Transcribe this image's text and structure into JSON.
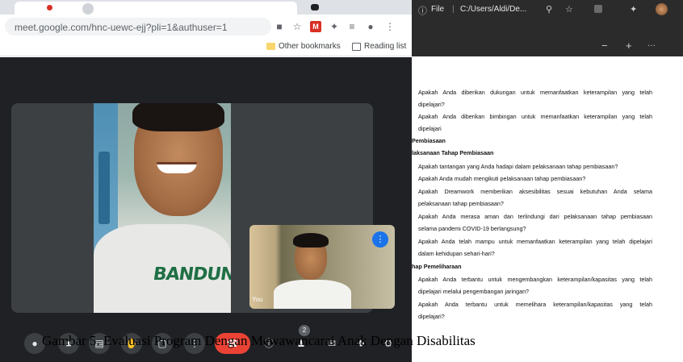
{
  "browser": {
    "url": "meet.google.com/hnc-uewc-ejj?pli=1&authuser=1",
    "bookmarks": [
      "Other bookmarks",
      "Reading list"
    ]
  },
  "meet": {
    "self_label": "You",
    "shirt_print": "BANDUN",
    "participant_badge": "2"
  },
  "edge": {
    "file_label": "File",
    "path": "C:/Users/Aldi/De...",
    "toolbar_glyphs": [
      "−",
      "+",
      "···"
    ]
  },
  "pdf": {
    "lines": [
      {
        "text": "Apakah Anda diberikan dukungan untuk memanfaatkan keterampilan yang telah",
        "style": "j"
      },
      {
        "text": "dipelajari?",
        "style": ""
      },
      {
        "text": "Apakah Anda diberikan bimbingan untuk memanfaatkan keterampilan yang telah",
        "style": "j"
      },
      {
        "text": "dipelajari",
        "style": ""
      },
      {
        "text": "Pembiasaan",
        "style": "b"
      },
      {
        "text": "laksanaan Tahap Pembiasaan",
        "style": "b"
      },
      {
        "text": "Apakah tantangan yang Anda hadapi dalam pelaksanaan tahap pembiasaan?",
        "style": ""
      },
      {
        "text": "Apakah Anda mudah mengikuti pelaksanaan tahap pembiasaan?",
        "style": ""
      },
      {
        "text": "Apakah Dreamwork memberikan aksesibilitas sesuai kebutuhan Anda selama",
        "style": "j"
      },
      {
        "text": "pelaksanaan tahap pembiasaan?",
        "style": ""
      },
      {
        "text": "Apakah Anda merasa aman dan terlindungi dari pelaksanaan tahap pembiasaan",
        "style": "j"
      },
      {
        "text": "selama pandemi COVID-19 berlangsung?",
        "style": ""
      },
      {
        "text": "Apakah Anda telah mampu untuk memanfaatkan keterampilan yang telah dipelajari",
        "style": "j"
      },
      {
        "text": "dalam kehidupan sehari-hari?",
        "style": ""
      },
      {
        "text": "hap Pemeliharaan",
        "style": "b"
      },
      {
        "text": "Apakah Anda terbantu untuk mengembangkan keterampilan/kapasitas yang telah",
        "style": "j"
      },
      {
        "text": "dipelajari melalui pengembangan jaringan?",
        "style": ""
      },
      {
        "text": "Apakah Anda terbantu untuk memelihara keterampilan/kapasitas yang telah",
        "style": "j"
      },
      {
        "text": "dipelajari?",
        "style": ""
      }
    ]
  },
  "caption": "Gambar 5. Evaluasi Program Dengan Mewawancarai Anak Dengan Disabilitas"
}
